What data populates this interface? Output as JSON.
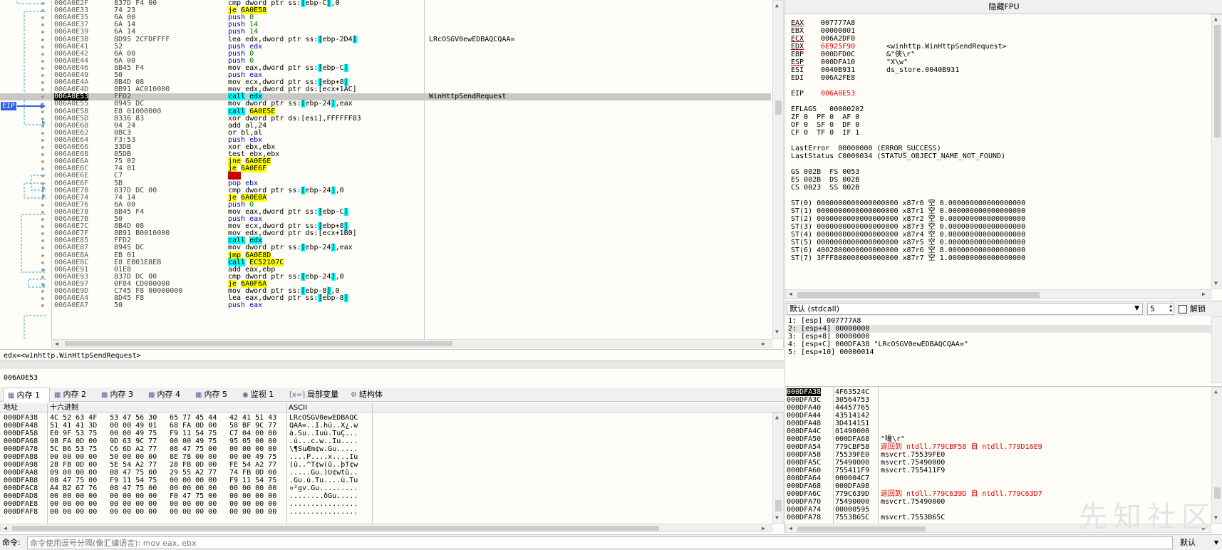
{
  "disasm": {
    "eip_label": "EIP",
    "rows": [
      {
        "addr": "006A0E2F",
        "bytes": "837D F4 00",
        "mn": "cmp",
        "ops": [
          {
            "t": "dword ptr ss:"
          },
          {
            "t": "[",
            "c": "tag"
          },
          {
            "t": "ebp-C"
          },
          {
            "t": "]",
            "c": "tag"
          },
          {
            "t": ",0"
          }
        ],
        "cm": ""
      },
      {
        "addr": "006A0E33",
        "bytes": "74 23",
        "mn": "je",
        "mnc": "hl",
        "ops": [
          {
            "t": "6A0E58",
            "c": "hl"
          }
        ],
        "cm": ""
      },
      {
        "addr": "006A0E35",
        "bytes": "6A 00",
        "mn": "push",
        "mnc": "blue",
        "ops": [
          {
            "t": "0",
            "c": "green"
          }
        ],
        "cm": ""
      },
      {
        "addr": "006A0E37",
        "bytes": "6A 14",
        "mn": "push",
        "mnc": "blue",
        "ops": [
          {
            "t": "14",
            "c": "green"
          }
        ],
        "cm": ""
      },
      {
        "addr": "006A0E39",
        "bytes": "6A 14",
        "mn": "push",
        "mnc": "blue",
        "ops": [
          {
            "t": "14",
            "c": "green"
          }
        ],
        "cm": ""
      },
      {
        "addr": "006A0E3B",
        "bytes": "8D95 2CFDFFFF",
        "mn": "lea",
        "ops": [
          {
            "t": "edx,dword ptr ss:"
          },
          {
            "t": "[",
            "c": "tag"
          },
          {
            "t": "ebp-2D4"
          },
          {
            "t": "]",
            "c": "tag"
          }
        ],
        "cm": "LRcOSGV0ewEDBAQCQAA="
      },
      {
        "addr": "006A0E41",
        "bytes": "52",
        "mn": "push",
        "mnc": "blue",
        "ops": [
          {
            "t": "edx",
            "c": "blue"
          }
        ],
        "cm": ""
      },
      {
        "addr": "006A0E42",
        "bytes": "6A 00",
        "mn": "push",
        "mnc": "blue",
        "ops": [
          {
            "t": "0",
            "c": "green"
          }
        ],
        "cm": ""
      },
      {
        "addr": "006A0E44",
        "bytes": "6A 00",
        "mn": "push",
        "mnc": "blue",
        "ops": [
          {
            "t": "0",
            "c": "green"
          }
        ],
        "cm": ""
      },
      {
        "addr": "006A0E46",
        "bytes": "8B45 F4",
        "mn": "mov",
        "ops": [
          {
            "t": "eax,dword ptr ss:"
          },
          {
            "t": "[",
            "c": "tag"
          },
          {
            "t": "ebp-C"
          },
          {
            "t": "]",
            "c": "tag"
          }
        ],
        "cm": ""
      },
      {
        "addr": "006A0E49",
        "bytes": "50",
        "mn": "push",
        "mnc": "blue",
        "ops": [
          {
            "t": "eax",
            "c": "blue"
          }
        ],
        "cm": ""
      },
      {
        "addr": "006A0E4A",
        "bytes": "8B4D 08",
        "mn": "mov",
        "ops": [
          {
            "t": "ecx,dword ptr ss:"
          },
          {
            "t": "[",
            "c": "tag"
          },
          {
            "t": "ebp+8"
          },
          {
            "t": "]",
            "c": "tag"
          }
        ],
        "cm": ""
      },
      {
        "addr": "006A0E4D",
        "bytes": "8B91 AC010000",
        "mn": "mov",
        "ops": [
          {
            "t": "edx,dword ptr ds:"
          },
          {
            "t": "[ecx+1AC]"
          }
        ],
        "cm": ""
      },
      {
        "addr": "006A0E53",
        "bytes": "FFD2",
        "mn": "call",
        "mnc": "tag",
        "ops": [
          {
            "t": "edx",
            "c": "tag"
          }
        ],
        "cm": "WinHttpSendRequest",
        "cur": true
      },
      {
        "addr": "006A0E55",
        "bytes": "8945 DC",
        "mn": "mov",
        "ops": [
          {
            "t": "dword ptr ss:"
          },
          {
            "t": "[",
            "c": "tag"
          },
          {
            "t": "ebp-24"
          },
          {
            "t": "]",
            "c": "tag"
          },
          {
            "t": ",eax"
          }
        ],
        "cm": ""
      },
      {
        "addr": "006A0E58",
        "bytes": "E8 01000000",
        "mn": "call",
        "mnc": "tag",
        "ops": [
          {
            "t": "6A0E5E",
            "c": "hl"
          }
        ],
        "cm": ""
      },
      {
        "addr": "006A0E5D",
        "bytes": "8336 83",
        "mn": "xor",
        "ops": [
          {
            "t": "dword ptr ds:[esi],FFFFFF83"
          }
        ],
        "cm": ""
      },
      {
        "addr": "006A0E60",
        "bytes": "04 24",
        "mn": "add",
        "ops": [
          {
            "t": "al,24"
          }
        ],
        "cm": ""
      },
      {
        "addr": "006A0E62",
        "bytes": "08C3",
        "mn": "or",
        "ops": [
          {
            "t": "bl,al"
          }
        ],
        "cm": ""
      },
      {
        "addr": "006A0E64",
        "bytes": "F3:53",
        "mn": "push",
        "mnc": "blue",
        "ops": [
          {
            "t": "ebx",
            "c": "blue"
          }
        ],
        "cm": ""
      },
      {
        "addr": "006A0E66",
        "bytes": "33DB",
        "mn": "xor",
        "ops": [
          {
            "t": "ebx,ebx"
          }
        ],
        "cm": ""
      },
      {
        "addr": "006A0E68",
        "bytes": "85DB",
        "mn": "test",
        "ops": [
          {
            "t": "ebx,ebx"
          }
        ],
        "cm": ""
      },
      {
        "addr": "006A0E6A",
        "bytes": "75 02",
        "mn": "jne",
        "mnc": "hl",
        "ops": [
          {
            "t": "6A0E6E",
            "c": "hl"
          }
        ],
        "cm": ""
      },
      {
        "addr": "006A0E6C",
        "bytes": "74 01",
        "mn": "je",
        "mnc": "hl",
        "ops": [
          {
            "t": "6A0E6F",
            "c": "hl"
          }
        ],
        "cm": ""
      },
      {
        "addr": "006A0E6E",
        "bytes": "C7",
        "mn": "???",
        "mnc": "bad",
        "ops": [],
        "cm": ""
      },
      {
        "addr": "006A0E6F",
        "bytes": "5B",
        "mn": "pop",
        "mnc": "blue",
        "ops": [
          {
            "t": "ebx",
            "c": "blue"
          }
        ],
        "cm": ""
      },
      {
        "addr": "006A0E70",
        "bytes": "837D DC 00",
        "mn": "cmp",
        "ops": [
          {
            "t": "dword ptr ss:"
          },
          {
            "t": "[",
            "c": "tag"
          },
          {
            "t": "ebp-24"
          },
          {
            "t": "]",
            "c": "tag"
          },
          {
            "t": ",0"
          }
        ],
        "cm": ""
      },
      {
        "addr": "006A0E74",
        "bytes": "74 14",
        "mn": "je",
        "mnc": "hl",
        "ops": [
          {
            "t": "6A0E8A",
            "c": "hl"
          }
        ],
        "cm": ""
      },
      {
        "addr": "006A0E76",
        "bytes": "6A 00",
        "mn": "push",
        "mnc": "blue",
        "ops": [
          {
            "t": "0",
            "c": "green"
          }
        ],
        "cm": ""
      },
      {
        "addr": "006A0E78",
        "bytes": "8B45 F4",
        "mn": "mov",
        "ops": [
          {
            "t": "eax,dword ptr ss:"
          },
          {
            "t": "[",
            "c": "tag"
          },
          {
            "t": "ebp-C"
          },
          {
            "t": "]",
            "c": "tag"
          }
        ],
        "cm": ""
      },
      {
        "addr": "006A0E7B",
        "bytes": "50",
        "mn": "push",
        "mnc": "blue",
        "ops": [
          {
            "t": "eax",
            "c": "blue"
          }
        ],
        "cm": ""
      },
      {
        "addr": "006A0E7C",
        "bytes": "8B4D 08",
        "mn": "mov",
        "ops": [
          {
            "t": "ecx,dword ptr ss:"
          },
          {
            "t": "[",
            "c": "tag"
          },
          {
            "t": "ebp+8"
          },
          {
            "t": "]",
            "c": "tag"
          }
        ],
        "cm": ""
      },
      {
        "addr": "006A0E7F",
        "bytes": "8B91 B0010000",
        "mn": "mov",
        "ops": [
          {
            "t": "edx,dword ptr ds:"
          },
          {
            "t": "[ecx+1B0]"
          }
        ],
        "cm": ""
      },
      {
        "addr": "006A0E85",
        "bytes": "FFD2",
        "mn": "call",
        "mnc": "tag",
        "ops": [
          {
            "t": "edx",
            "c": "tag"
          }
        ],
        "cm": ""
      },
      {
        "addr": "006A0E87",
        "bytes": "8945 DC",
        "mn": "mov",
        "ops": [
          {
            "t": "dword ptr ss:"
          },
          {
            "t": "[",
            "c": "tag"
          },
          {
            "t": "ebp-24"
          },
          {
            "t": "]",
            "c": "tag"
          },
          {
            "t": ",eax"
          }
        ],
        "cm": ""
      },
      {
        "addr": "006A0E8A",
        "bytes": "EB 01",
        "mn": "jmp",
        "mnc": "hl",
        "ops": [
          {
            "t": "6A0E8D",
            "c": "hl"
          }
        ],
        "cm": ""
      },
      {
        "addr": "006A0E8C",
        "bytes": "E8 EB01E8EB",
        "mn": "call",
        "mnc": "tag",
        "ops": [
          {
            "t": "EC52107C",
            "c": "hl"
          }
        ],
        "cm": ""
      },
      {
        "addr": "006A0E91",
        "bytes": "01E8",
        "mn": "add",
        "ops": [
          {
            "t": "eax,ebp"
          }
        ],
        "cm": ""
      },
      {
        "addr": "006A0E93",
        "bytes": "837D DC 00",
        "mn": "cmp",
        "ops": [
          {
            "t": "dword ptr ss:"
          },
          {
            "t": "[",
            "c": "tag"
          },
          {
            "t": "ebp-24"
          },
          {
            "t": "]",
            "c": "tag"
          },
          {
            "t": ",0"
          }
        ],
        "cm": ""
      },
      {
        "addr": "006A0E97",
        "bytes": "0F84 CD000000",
        "mn": "je",
        "mnc": "hl",
        "ops": [
          {
            "t": "6A0F6A",
            "c": "hl"
          }
        ],
        "cm": ""
      },
      {
        "addr": "006A0E9D",
        "bytes": "C745 F8 00000000",
        "mn": "mov",
        "ops": [
          {
            "t": "dword ptr ss:"
          },
          {
            "t": "[",
            "c": "tag"
          },
          {
            "t": "ebp-8"
          },
          {
            "t": "]",
            "c": "tag"
          },
          {
            "t": ",0"
          }
        ],
        "cm": ""
      },
      {
        "addr": "006A0EA4",
        "bytes": "8D45 F8",
        "mn": "lea",
        "ops": [
          {
            "t": "eax,dword ptr ss:"
          },
          {
            "t": "[",
            "c": "tag"
          },
          {
            "t": "ebp-8"
          },
          {
            "t": "]",
            "c": "tag"
          }
        ],
        "cm": ""
      },
      {
        "addr": "006A0EA7",
        "bytes": "50",
        "mn": "push",
        "mnc": "blue",
        "ops": [
          {
            "t": "eax",
            "c": "blue"
          }
        ],
        "cm": ""
      }
    ]
  },
  "info": {
    "line1": "edx=<winhttp.WinHttpSendRequest>",
    "line2": "006A0E53"
  },
  "registers": {
    "title": "隐藏FPU",
    "gpr": [
      {
        "n": "EAX",
        "v": "007777A8",
        "ul": true
      },
      {
        "n": "EBX",
        "v": "00000001"
      },
      {
        "n": "ECX",
        "v": "006A2DF0",
        "ul": true
      },
      {
        "n": "EDX",
        "v": "6E925F90",
        "ul": true,
        "red": true,
        "c": "<winhttp.WinHttpSendRequest>"
      },
      {
        "n": "EBP",
        "v": "000DFD0C",
        "c": "&\"俠\\r\""
      },
      {
        "n": "ESP",
        "v": "000DFA10",
        "ul": true,
        "c": "\"X\\w\""
      },
      {
        "n": "ESI",
        "v": "0040B931",
        "c": "ds_store.0040B931"
      },
      {
        "n": "EDI",
        "v": "006A2FE8"
      }
    ],
    "eip_name": "EIP",
    "eip_value": "006A0E53",
    "eflags_line": "EFLAGS   00000202",
    "flags": [
      "ZF 0  PF 0  AF 0",
      "OF 0  SF 0  DF 0",
      "CF 0  TF 0  IF 1"
    ],
    "lasterror": "LastError  00000000 (ERROR_SUCCESS)",
    "laststatus": "LastStatus C0000034 (STATUS_OBJECT_NAME_NOT_FOUND)",
    "seg": [
      "GS 002B  FS 0053",
      "ES 002B  DS 002B",
      "CS 0023  SS 002B"
    ],
    "fpu": [
      "ST(0) 0000000000000000000 x87r0 空 0.000000000000000000",
      "ST(1) 0000000000000000000 x87r1 空 0.000000000000000000",
      "ST(2) 0000000000000000000 x87r2 空 0.000000000000000000",
      "ST(3) 0000000000000000000 x87r3 空 0.000000000000000000",
      "ST(4) 0000000000000000000 x87r4 空 0.000000000000000000",
      "ST(5) 0000000000000000000 x87r5 空 0.000000000000000000",
      "ST(6) 4002800000000000000 x87r6 空 8.000000000000000000",
      "ST(7) 3FFF800000000000000 x87r7 空 1.000000000000000000"
    ]
  },
  "callconv": {
    "label": "默认 (stdcall)",
    "count": "5",
    "unlock_label": "解锁",
    "args": [
      "1: [esp] 007777A8",
      "2: [esp+4] 00000000",
      "3: [esp+8] 00000000",
      "4: [esp+C] 000DFA38 \"LRcOSGV0ewEDBAQCQAA=\"",
      "5: [esp+10] 00000014"
    ]
  },
  "tabs": [
    {
      "icon": "▦",
      "label": "内存 1",
      "active": true
    },
    {
      "icon": "▦",
      "label": "内存 2"
    },
    {
      "icon": "▦",
      "label": "内存 3"
    },
    {
      "icon": "▦",
      "label": "内存 4"
    },
    {
      "icon": "▦",
      "label": "内存 5"
    },
    {
      "icon": "◉",
      "label": "监视 1"
    },
    {
      "icon": "[x=]",
      "label": "局部变量"
    },
    {
      "icon": "⚙",
      "label": "结构体"
    }
  ],
  "dump": {
    "headers": {
      "addr": "地址",
      "hex": "十六进制",
      "ascii": "ASCII"
    },
    "rows": [
      {
        "a": "000DFA38",
        "h": "4C 52 63 4F 53 47 56 30 65 77 45 44 42 41 51 43",
        "s": "LRcOSGV0ewEDBAQC"
      },
      {
        "a": "000DFA48",
        "h": "51 41 41 3D 00 00 49 01 68 FA 0D 00 58 BF 9C 77",
        "s": "QAA=..I.hú..X¿.w"
      },
      {
        "a": "000DFA58",
        "h": "E0 9F 53 75 00 00 49 75 F9 11 54 75 C7 04 00 00",
        "s": "à.Su..Iuù.TuÇ..."
      },
      {
        "a": "000DFA68",
        "h": "98 FA 0D 00 9D 63 9C 77 00 00 49 75 95 05 00 00",
        "s": ".ú...c.w..Iu...."
      },
      {
        "a": "000DFA78",
        "h": "5C B6 53 75 C6 6D A2 77 08 47 75 00 00 00 00 00",
        "s": "\\¶SuÆm¢w.Gu....."
      },
      {
        "a": "000DFA88",
        "h": "00 00 00 00 50 00 00 00 8E 78 00 00 00 00 49 75",
        "s": "....P....x....Iu"
      },
      {
        "a": "000DFA98",
        "h": "28 FB 0D 00 5E 54 A2 77 28 FB 0D 00 FE 54 A2 77",
        "s": "(û..^T¢w(û..þT¢w"
      },
      {
        "a": "000DFAA8",
        "h": "09 00 00 00 08 47 75 00 29 55 A2 77 74 FB 0D 00",
        "s": ".....Gu.)U¢wtû.."
      },
      {
        "a": "000DFAB8",
        "h": "08 47 75 00 F9 11 54 75 00 00 00 00 F9 11 54 75",
        "s": ".Gu.ù.Tu....ù.Tu"
      },
      {
        "a": "000DFAC8",
        "h": "A4 B2 67 76 08 47 75 00 00 00 00 00 00 00 00 00",
        "s": "¤²gv.Gu........."
      },
      {
        "a": "000DFAD8",
        "h": "00 00 00 00 00 00 00 00 F0 47 75 00 00 00 00 00",
        "s": "........ðGu....."
      },
      {
        "a": "000DFAE8",
        "h": "00 00 00 00 00 00 00 00 00 00 00 00 00 00 00 00",
        "s": "................"
      },
      {
        "a": "000DFAF8",
        "h": "00 00 00 00 00 00 00 00 00 00 00 00 00 00 00 00",
        "s": "................"
      }
    ]
  },
  "stack": {
    "rows": [
      {
        "a": "000DFA38",
        "v": "4F63524C",
        "c": "",
        "cur": true
      },
      {
        "a": "000DFA3C",
        "v": "30564753",
        "c": ""
      },
      {
        "a": "000DFA40",
        "v": "44457765",
        "c": ""
      },
      {
        "a": "000DFA44",
        "v": "43514142",
        "c": ""
      },
      {
        "a": "000DFA48",
        "v": "3D414151",
        "c": ""
      },
      {
        "a": "000DFA4C",
        "v": "01490000",
        "c": ""
      },
      {
        "a": "000DFA50",
        "v": "000DFA68",
        "c": "\"嘬\\r\""
      },
      {
        "a": "000DFA54",
        "v": "779CBF58",
        "c": "返回到 ntdll.779CBF58 自 ntdll.779D16E9",
        "red": true
      },
      {
        "a": "000DFA58",
        "v": "75539FE0",
        "c": "msvcrt.75539FE0"
      },
      {
        "a": "000DFA5C",
        "v": "75490000",
        "c": "msvcrt.75490000"
      },
      {
        "a": "000DFA60",
        "v": "755411F9",
        "c": "msvcrt.755411F9"
      },
      {
        "a": "000DFA64",
        "v": "000004C7",
        "c": ""
      },
      {
        "a": "000DFA68",
        "v": "000DFA98",
        "c": ""
      },
      {
        "a": "000DFA6C",
        "v": "779C639D",
        "c": "返回到 ntdll.779C639D 自 ntdll.779C63D7",
        "red": true
      },
      {
        "a": "000DFA70",
        "v": "75490000",
        "c": "msvcrt.75490000"
      },
      {
        "a": "000DFA74",
        "v": "00000595",
        "c": ""
      },
      {
        "a": "000DFA78",
        "v": "7553B65C",
        "c": "msvcrt.7553B65C"
      }
    ]
  },
  "command": {
    "label": "命令:",
    "placeholder": "命令使用逗号分隔(像汇编语言): mov eax, ebx",
    "mode": "默认"
  },
  "watermark": "先知社区"
}
